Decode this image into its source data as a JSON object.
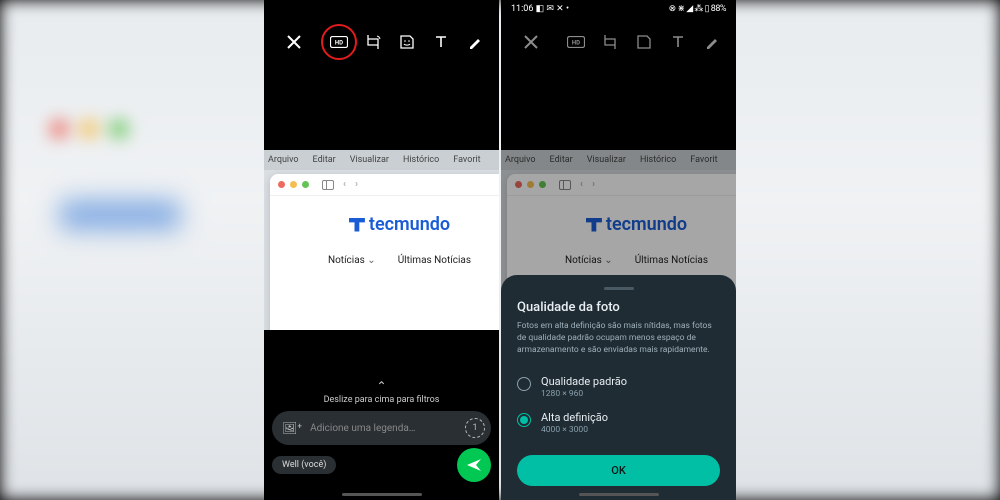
{
  "blurred_bg": {
    "app_hint": "tecmundo"
  },
  "left": {
    "toolbar": {
      "hd_highlighted": true
    },
    "preview_menu": [
      "Arquivo",
      "Editar",
      "Visualizar",
      "Histórico",
      "Favorit"
    ],
    "brand": "tecmundo",
    "nav_links": [
      "Notícias",
      "Últimas Notícias"
    ],
    "swipe_hint": "Deslize para cima para filtros",
    "caption_placeholder": "Adicione uma legenda…",
    "recipient_chip": "Well (você)"
  },
  "right": {
    "statusbar": {
      "time": "11:06",
      "left_icons": "◧ ✉ ✕ •",
      "right_icons": "⊗ ⋇ ◢ ⁂ ▯ 88%"
    },
    "preview_menu": [
      "Arquivo",
      "Editar",
      "Visualizar",
      "Histórico",
      "Favorit"
    ],
    "brand": "tecmundo",
    "nav_links": [
      "Notícias",
      "Últimas Notícias"
    ],
    "sheet": {
      "title": "Qualidade da foto",
      "description": "Fotos em alta definição são mais nítidas, mas fotos de qualidade padrão ocupam menos espaço de armazenamento e são enviadas mais rapidamente.",
      "options": [
        {
          "label": "Qualidade padrão",
          "sub": "1280 × 960",
          "selected": false
        },
        {
          "label": "Alta definição",
          "sub": "4000 × 3000",
          "selected": true
        }
      ],
      "ok": "OK"
    }
  }
}
